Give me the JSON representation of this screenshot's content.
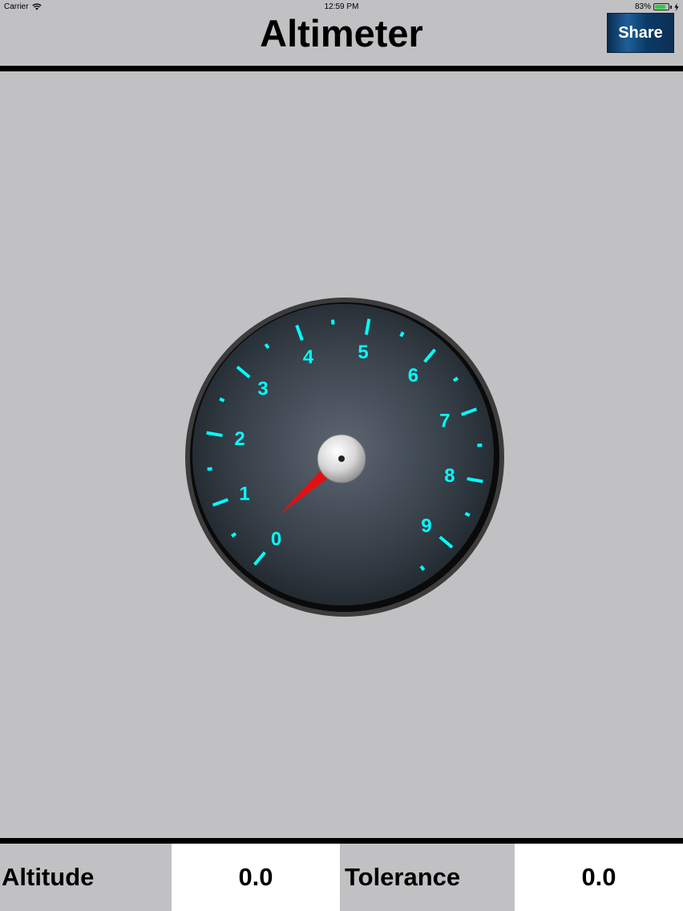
{
  "status_bar": {
    "carrier": "Carrier",
    "time": "12:59 PM",
    "battery": "83%",
    "battery_level": 0.83
  },
  "header": {
    "title": "Altimeter",
    "share_label": "Share"
  },
  "gauge": {
    "scale_labels": [
      "0",
      "1",
      "2",
      "3",
      "4",
      "5",
      "6",
      "7",
      "8",
      "9"
    ],
    "needle_value": 0,
    "tick_color": "#00ffff",
    "needle_color": "#e31010"
  },
  "footer": {
    "altitude_label": "Altitude",
    "altitude_value": "0.0",
    "tolerance_label": "Tolerance",
    "tolerance_value": "0.0"
  }
}
